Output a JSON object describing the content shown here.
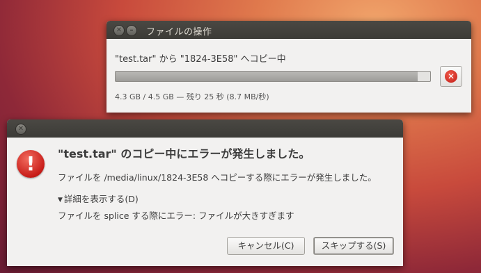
{
  "copy_window": {
    "title": "ファイルの操作",
    "status": "\"test.tar\" から \"1824-3E58\" へコピー中",
    "progress": 0.96,
    "detail": "4.3 GB / 4.5 GB — 残り 25 秒 (8.7 MB/秒)",
    "close_glyph": "✕",
    "minimize_glyph": "–",
    "stop_glyph": "✕"
  },
  "error_dialog": {
    "close_glyph": "✕",
    "icon_glyph": "!",
    "heading": "\"test.tar\" のコピー中にエラーが発生しました。",
    "message": "ファイルを /media/linux/1824-3E58 へコピーする際にエラーが発生しました。",
    "expander_arrow": "▼",
    "expander_label": "詳細を表示する(D)",
    "details": "ファイルを splice する際にエラー: ファイルが大きすぎます",
    "cancel_label": "キャンセル(C)",
    "skip_label": "スキップする(S)"
  },
  "colors": {
    "error_red": "#c81d19",
    "titlebar": "#3c3b37",
    "dialog_bg": "#f2f1f0"
  },
  "icons": [
    "close-icon",
    "minimize-icon",
    "stop-icon",
    "error-icon",
    "expander-arrow-icon"
  ]
}
